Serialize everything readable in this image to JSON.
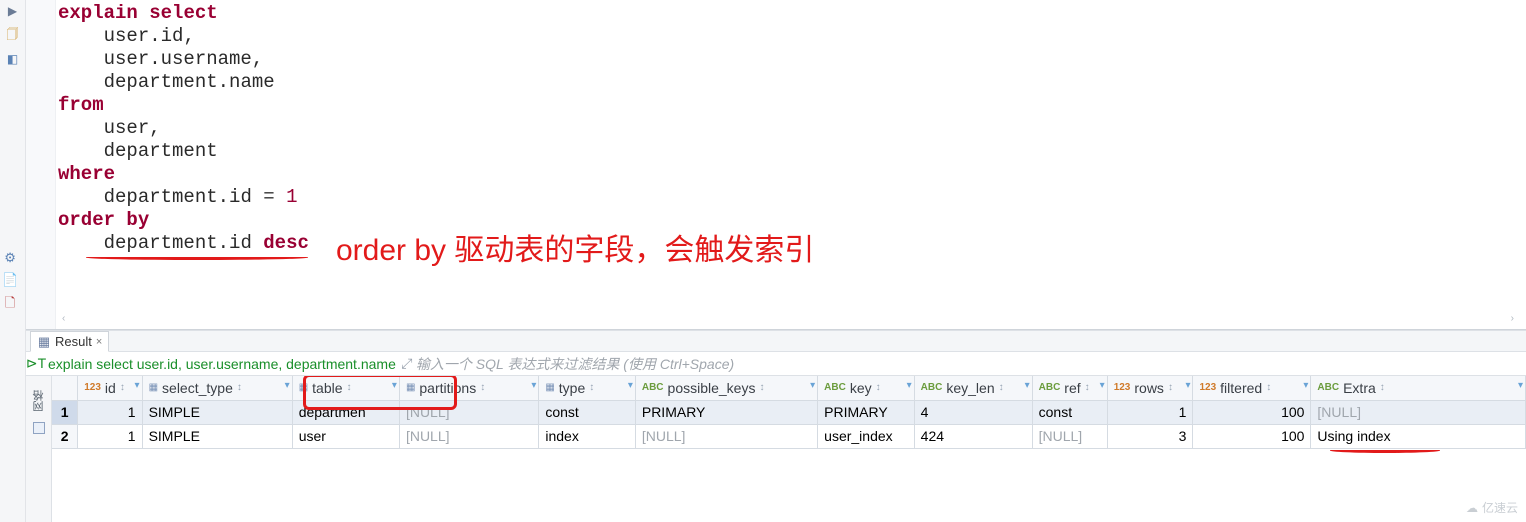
{
  "sql": {
    "line1_kw1": "explain",
    "line1_kw2": "select",
    "line2_ident": "user",
    "line2_member": ".id",
    "line2_comma": ",",
    "line3_ident": "user",
    "line3_member": ".username",
    "line3_comma": ",",
    "line4_ident": "department",
    "line4_member": ".name",
    "line5_kw": "from",
    "line6_ident": "user",
    "line6_comma": ",",
    "line7_ident": "department",
    "line8_kw": "where",
    "line9_ident": "department",
    "line9_member": ".id",
    "line9_eq": " = ",
    "line9_num": "1",
    "line10_kw": "order by",
    "line11_ident": "department",
    "line11_member": ".id",
    "line11_kw": "desc"
  },
  "annotation": {
    "text": "order by 驱动表的字段，会触发索引"
  },
  "result_tab": {
    "label": "Result"
  },
  "filter": {
    "query_text": "explain select user.id, user.username, department.name",
    "placeholder": "输入一个 SQL 表达式来过滤结果 (使用 Ctrl+Space)"
  },
  "side_panel": {
    "vertical_label": "网格"
  },
  "columns": {
    "c0": "",
    "c1": "id",
    "c2": "select_type",
    "c3": "table",
    "c4": "partitions",
    "c5": "type",
    "c6": "possible_keys",
    "c7": "key",
    "c8": "key_len",
    "c9": "ref",
    "c10": "rows",
    "c11": "filtered",
    "c12": "Extra"
  },
  "rows": [
    {
      "n": "1",
      "id": "1",
      "select_type": "SIMPLE",
      "table": "departmen",
      "partitions": "[NULL]",
      "type": "const",
      "possible_keys": "PRIMARY",
      "key": "PRIMARY",
      "key_len": "4",
      "ref": "const",
      "rows_v": "1",
      "filtered": "100",
      "extra": "[NULL]"
    },
    {
      "n": "2",
      "id": "1",
      "select_type": "SIMPLE",
      "table": "user",
      "partitions": "[NULL]",
      "type": "index",
      "possible_keys": "[NULL]",
      "key": "user_index",
      "key_len": "424",
      "ref": "[NULL]",
      "rows_v": "3",
      "filtered": "100",
      "extra": "Using index"
    }
  ],
  "watermark": {
    "text": "亿速云"
  }
}
